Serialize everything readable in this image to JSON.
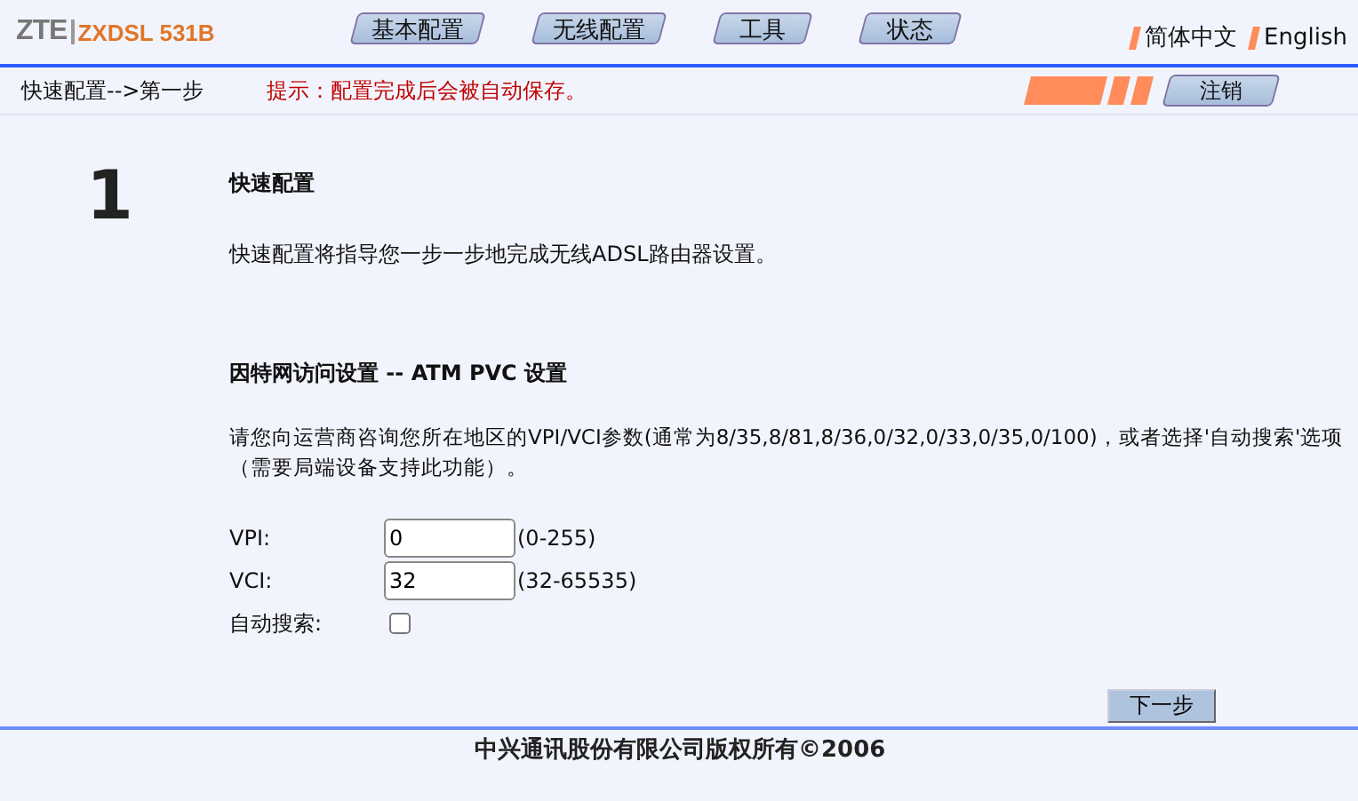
{
  "brand": {
    "logo": "ZTE",
    "model": "ZXDSL 531B"
  },
  "nav_tabs": [
    {
      "label": "基本配置"
    },
    {
      "label": "无线配置"
    },
    {
      "label": "工具"
    },
    {
      "label": "状态"
    }
  ],
  "languages": [
    {
      "label": "简体中文"
    },
    {
      "label": "English"
    }
  ],
  "breadcrumb": "快速配置-->第一步",
  "hint": "提示：配置完成后会被自动保存。",
  "logout_button": "注销",
  "step_number": "1",
  "section_title": "快速配置",
  "intro": "快速配置将指导您一步一步地完成无线ADSL路由器设置。",
  "atm_heading": "因特网访问设置 -- ATM PVC 设置",
  "atm_description": "请您向运营商咨询您所在地区的VPI/VCI参数(通常为8/35,8/81,8/36,0/32,0/33,0/35,0/100)，或者选择'自动搜索'选项（需要局端设备支持此功能）。",
  "fields": [
    {
      "kind": "text",
      "label": "VPI:",
      "value": "0",
      "range": "(0-255)"
    },
    {
      "kind": "text",
      "label": "VCI:",
      "value": "32",
      "range": "(32-65535)"
    },
    {
      "kind": "checkbox",
      "label": "自动搜索:",
      "checked": false
    }
  ],
  "next_button": "下一步",
  "footer": "中兴通讯股份有限公司版权所有©2006"
}
